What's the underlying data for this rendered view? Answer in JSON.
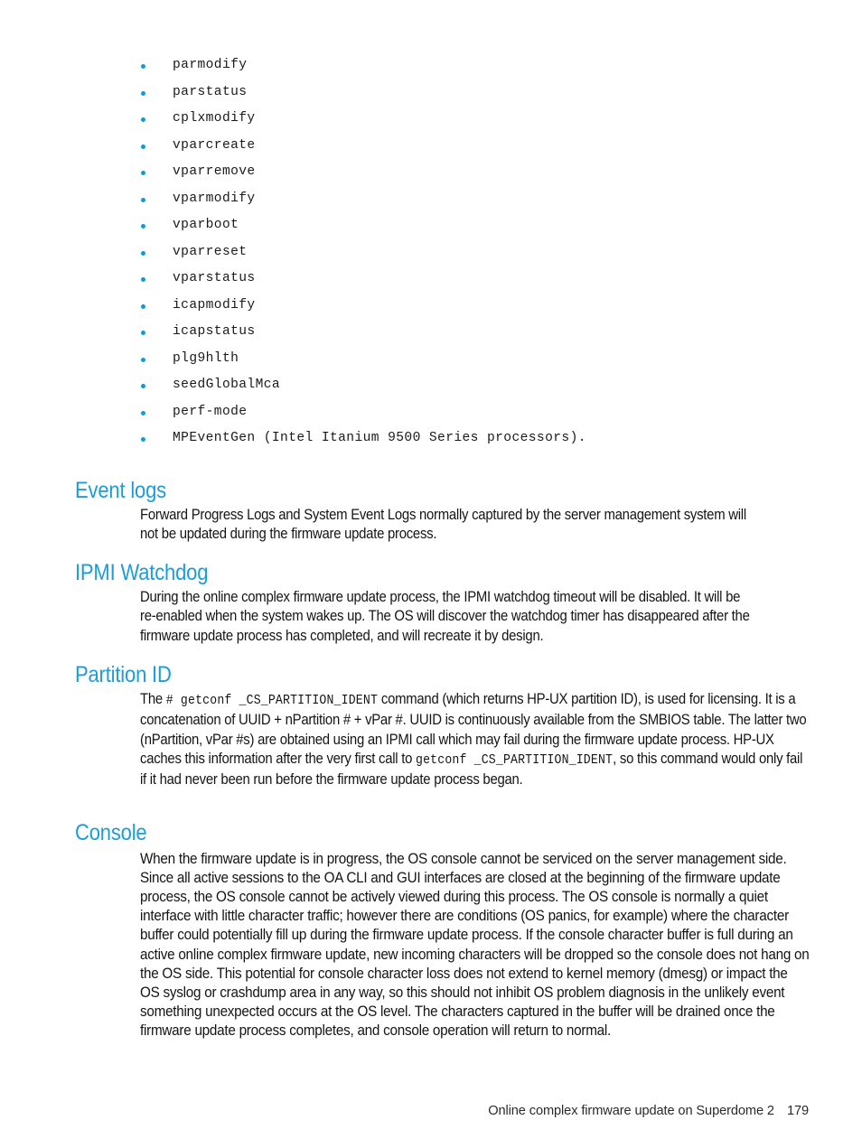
{
  "page": {
    "number": "179",
    "footer_title": "Online complex firmware update on Superdome 2",
    "heading_color": "#1b9ddb",
    "bullet_color": "#0b9dd7",
    "body_color": "#141414"
  },
  "command_list": {
    "items": [
      "parmodify",
      "parstatus",
      "cplxmodify",
      "vparcreate",
      "vparremove",
      "vparmodify",
      "vparboot",
      "vparreset",
      "vparstatus",
      "icapmodify",
      "icapstatus",
      "plg9hlth",
      "seedGlobalMca",
      "perf-mode",
      "MPEventGen (Intel Itanium 9500 Series processors)."
    ]
  },
  "sections": {
    "event_logs": {
      "heading": "Event logs",
      "body": "Forward Progress Logs and System Event Logs normally captured by the server management system will not be updated during the firmware update process."
    },
    "ipmi_watchdog": {
      "heading": "IPMI Watchdog",
      "body": "During the online complex firmware update process, the IPMI watchdog timeout will be disabled. It will be re-enabled when the system wakes up. The OS will discover the watchdog timer has disappeared after the firmware update process has completed, and will recreate it by design."
    },
    "partition_id": {
      "heading": "Partition ID",
      "body_part1": "The ",
      "code1": "# getconf _CS_PARTITION_IDENT",
      "body_part2": " command (which returns HP-UX partition ID), is used for licensing. It is a concatenation of UUID + nPartition # + vPar #. UUID is continuously available from the SMBIOS table. The latter two (nPartition, vPar #s) are obtained using an IPMI call which may fail during the firmware update process. HP-UX caches this information after the very first call to ",
      "code2": "getconf _CS_PARTITION_IDENT",
      "body_part3": ", so this command would only fail if it had never been run before the firmware update process began."
    },
    "console": {
      "heading": "Console",
      "body": "When the firmware update is in progress, the OS console cannot be serviced on the server management side. Since all active sessions to the OA CLI and GUI interfaces are closed at the beginning of the firmware update process, the OS console cannot be actively viewed during this process. The OS console is normally a quiet interface with little character traffic; however there are conditions (OS panics, for example) where the character buffer could potentially fill up during the firmware update process. If the console character buffer is full during an active online complex firmware update, new incoming characters will be dropped so the console does not hang on the OS side. This potential for console character loss does not extend to kernel memory (dmesg) or impact the OS syslog or crashdump area in any way, so this should not inhibit OS problem diagnosis in the unlikely event something unexpected occurs at the OS level. The characters captured in the buffer will be drained once the firmware update process completes, and console operation will return to normal."
    }
  }
}
